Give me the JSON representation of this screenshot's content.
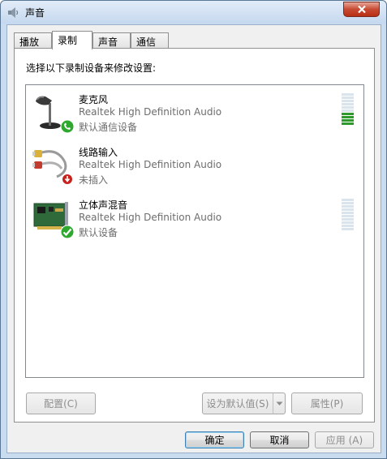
{
  "window": {
    "title": "声音",
    "icon": "speaker-icon",
    "close_icon": "close-icon"
  },
  "tabs": [
    {
      "label": "播放"
    },
    {
      "label": "录制",
      "active": true
    },
    {
      "label": "声音"
    },
    {
      "label": "通信"
    }
  ],
  "panel": {
    "prompt": "选择以下录制设备来修改设置:"
  },
  "devices": [
    {
      "name": "麦克风",
      "driver": "Realtek High Definition Audio",
      "status": "默认通信设备",
      "icon": "microphone-icon",
      "badge": "phone-badge-icon",
      "level_fraction": 0.4
    },
    {
      "name": "线路输入",
      "driver": "Realtek High Definition Audio",
      "status": "未插入",
      "icon": "line-in-cable-icon",
      "badge": "unplugged-badge-icon"
    },
    {
      "name": "立体声混音",
      "driver": "Realtek High Definition Audio",
      "status": "默认设备",
      "icon": "sound-card-icon",
      "badge": "check-badge-icon",
      "level_fraction": 0
    }
  ],
  "buttons": {
    "configure": "配置(C)",
    "set_default": "设为默认值(S)",
    "properties": "属性(P)",
    "ok": "确定",
    "cancel": "取消",
    "apply": "应用 (A)"
  },
  "colors": {
    "meter_active": "#2e9a2e",
    "meter_inactive": "#d9e4ec",
    "status_ok_green": "#2fa82f",
    "unplugged_red": "#c8201a"
  }
}
